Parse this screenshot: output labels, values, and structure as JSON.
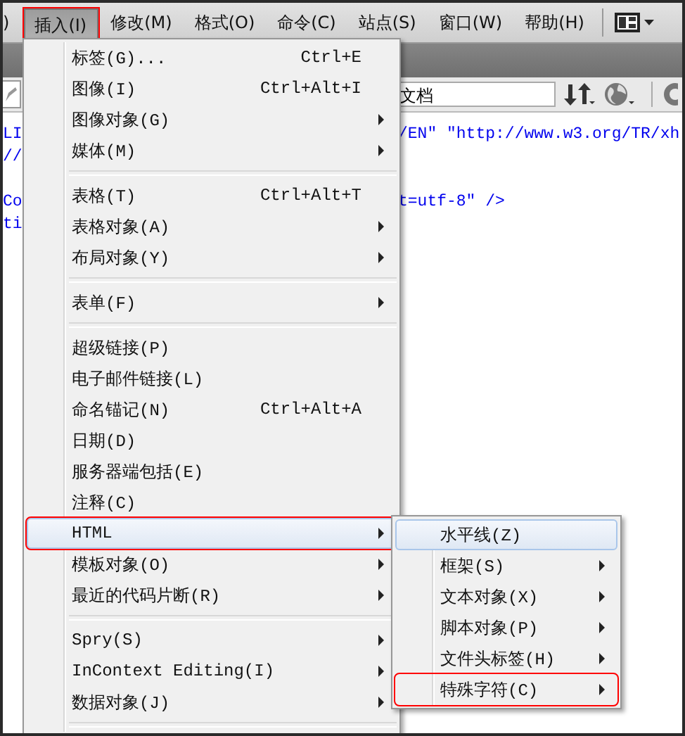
{
  "menubar": [
    {
      "label": ")",
      "selected": false,
      "annotated": false
    },
    {
      "label": "插入(I)",
      "selected": true,
      "annotated": true
    },
    {
      "label": "修改(M)",
      "selected": false,
      "annotated": false
    },
    {
      "label": "格式(O)",
      "selected": false,
      "annotated": false
    },
    {
      "label": "命令(C)",
      "selected": false,
      "annotated": false
    },
    {
      "label": "站点(S)",
      "selected": false,
      "annotated": false
    },
    {
      "label": "窗口(W)",
      "selected": false,
      "annotated": false
    },
    {
      "label": "帮助(H)",
      "selected": false,
      "annotated": false
    }
  ],
  "document_toolbar": {
    "title_field": {
      "value": "文档"
    }
  },
  "code_blocks": [
    [
      {
        "left": "LI",
        "right": "/EN\" \"http://www.w3.org/TR/xh"
      },
      {
        "left": "//"
      }
    ],
    [
      {
        "left": "Co",
        "right": "t=utf-8\" />"
      },
      {
        "left": "ti"
      }
    ]
  ],
  "insert_menu": [
    {
      "kind": "item",
      "label": "标签(G)...",
      "shortcut": "Ctrl+E",
      "submenu": false,
      "highlighted": false,
      "annotated": false
    },
    {
      "kind": "item",
      "label": "图像(I)",
      "shortcut": "Ctrl+Alt+I",
      "submenu": false,
      "highlighted": false,
      "annotated": false
    },
    {
      "kind": "item",
      "label": "图像对象(G)",
      "submenu": true,
      "highlighted": false,
      "annotated": false
    },
    {
      "kind": "item",
      "label": "媒体(M)",
      "submenu": true,
      "highlighted": false,
      "annotated": false
    },
    {
      "kind": "separator"
    },
    {
      "kind": "item",
      "label": "表格(T)",
      "shortcut": "Ctrl+Alt+T",
      "submenu": false,
      "highlighted": false,
      "annotated": false
    },
    {
      "kind": "item",
      "label": "表格对象(A)",
      "submenu": true,
      "highlighted": false,
      "annotated": false
    },
    {
      "kind": "item",
      "label": "布局对象(Y)",
      "submenu": true,
      "highlighted": false,
      "annotated": false
    },
    {
      "kind": "separator"
    },
    {
      "kind": "item",
      "label": "表单(F)",
      "submenu": true,
      "highlighted": false,
      "annotated": false
    },
    {
      "kind": "separator"
    },
    {
      "kind": "item",
      "label": "超级链接(P)",
      "submenu": false,
      "highlighted": false,
      "annotated": false
    },
    {
      "kind": "item",
      "label": "电子邮件链接(L)",
      "submenu": false,
      "highlighted": false,
      "annotated": false
    },
    {
      "kind": "item",
      "label": "命名锚记(N)",
      "shortcut": "Ctrl+Alt+A",
      "submenu": false,
      "highlighted": false,
      "annotated": false
    },
    {
      "kind": "item",
      "label": "日期(D)",
      "submenu": false,
      "highlighted": false,
      "annotated": false
    },
    {
      "kind": "item",
      "label": "服务器端包括(E)",
      "submenu": false,
      "highlighted": false,
      "annotated": false
    },
    {
      "kind": "item",
      "label": "注释(C)",
      "submenu": false,
      "highlighted": false,
      "annotated": false
    },
    {
      "kind": "item",
      "label": "HTML",
      "submenu": true,
      "highlighted": true,
      "annotated": true
    },
    {
      "kind": "item",
      "label": "模板对象(O)",
      "submenu": true,
      "highlighted": false,
      "annotated": false
    },
    {
      "kind": "item",
      "label": "最近的代码片断(R)",
      "submenu": true,
      "highlighted": false,
      "annotated": false
    },
    {
      "kind": "separator"
    },
    {
      "kind": "item",
      "label": "Spry(S)",
      "submenu": true,
      "highlighted": false,
      "annotated": false
    },
    {
      "kind": "item",
      "label": "InContext Editing(I)",
      "submenu": true,
      "highlighted": false,
      "annotated": false
    },
    {
      "kind": "item",
      "label": "数据对象(J)",
      "submenu": true,
      "highlighted": false,
      "annotated": false
    },
    {
      "kind": "separator"
    }
  ],
  "html_submenu": [
    {
      "kind": "item",
      "label": "水平线(Z)",
      "submenu": false,
      "highlighted": true,
      "annotated": false
    },
    {
      "kind": "item",
      "label": "框架(S)",
      "submenu": true,
      "highlighted": false,
      "annotated": false
    },
    {
      "kind": "item",
      "label": "文本对象(X)",
      "submenu": true,
      "highlighted": false,
      "annotated": false
    },
    {
      "kind": "item",
      "label": "脚本对象(P)",
      "submenu": true,
      "highlighted": false,
      "annotated": false
    },
    {
      "kind": "item",
      "label": "文件头标签(H)",
      "submenu": true,
      "highlighted": false,
      "annotated": false
    },
    {
      "kind": "item",
      "label": "特殊字符(C)",
      "submenu": true,
      "highlighted": false,
      "annotated": true
    }
  ]
}
